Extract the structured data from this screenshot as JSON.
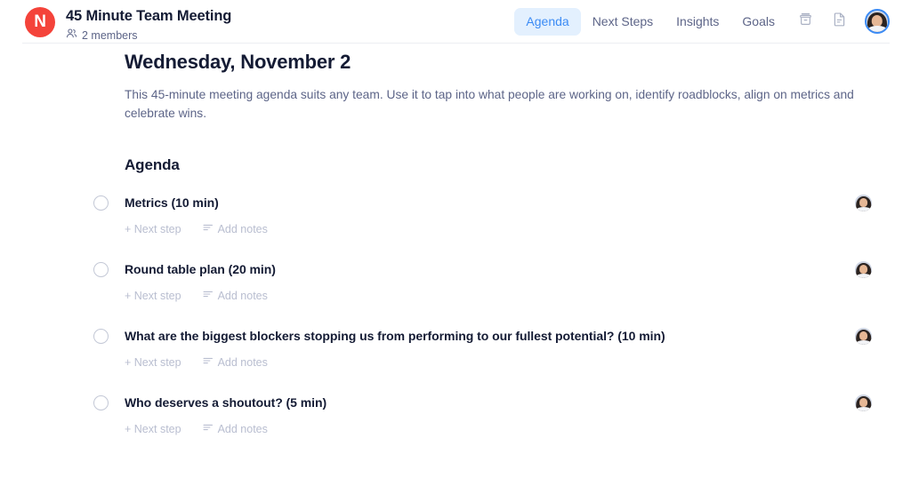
{
  "header": {
    "logo_letter": "N",
    "logo_color": "#f4433a",
    "title": "45 Minute Team Meeting",
    "members_text": "2 members",
    "people_icon": "people-icon",
    "nav_tabs": [
      {
        "label": "Agenda",
        "active": true
      },
      {
        "label": "Next Steps",
        "active": false
      },
      {
        "label": "Insights",
        "active": false
      },
      {
        "label": "Goals",
        "active": false
      }
    ],
    "active_tab_bg": "#e3f0fe",
    "active_tab_color": "#3b8bf5",
    "icons": [
      {
        "name": "archive-icon"
      },
      {
        "name": "document-icon"
      }
    ],
    "avatar": "user-avatar"
  },
  "main": {
    "date_heading": "Wednesday, November 2",
    "description": "This 45-minute meeting agenda suits any team. Use it to tap into what people are working on, identify roadblocks, align on metrics and celebrate wins.",
    "section_heading": "Agenda",
    "action_labels": {
      "next_step": "+ Next step",
      "add_notes": "Add notes",
      "notes_icon": "list-lines-icon"
    },
    "agenda_items": [
      {
        "title": "Metrics (10 min)",
        "checked": false,
        "assignee_avatar": "assignee-avatar"
      },
      {
        "title": "Round table plan (20 min)",
        "checked": false,
        "assignee_avatar": "assignee-avatar"
      },
      {
        "title": "What are the biggest blockers stopping us from performing to our fullest potential? (10 min)",
        "checked": false,
        "assignee_avatar": "assignee-avatar"
      },
      {
        "title": "Who deserves a shoutout? (5 min)",
        "checked": false,
        "assignee_avatar": "assignee-avatar"
      }
    ]
  },
  "colors": {
    "text_primary": "#141b34",
    "text_muted": "#5d6588",
    "text_faint": "#b9bed0",
    "accent": "#3b8bf5",
    "brand_red": "#f4433a"
  }
}
